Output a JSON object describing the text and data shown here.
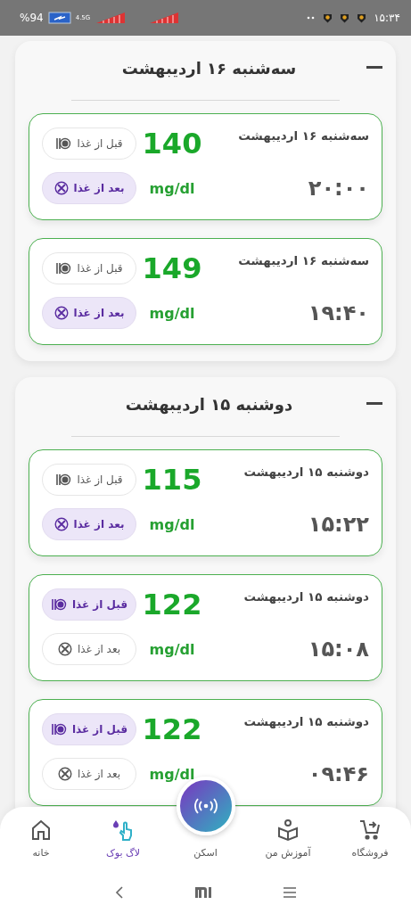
{
  "status_bar": {
    "time": "۱۵:۳۴",
    "battery": "%94",
    "network": "4.5G"
  },
  "days": [
    {
      "title": "سه‌شنبه ۱۶ اردیبهشت",
      "expanded": true,
      "entries": [
        {
          "date": "سه‌شنبه ۱۶ اردیبهشت",
          "value": "140",
          "unit": "mg/dl",
          "time": "۲۰:۰۰",
          "tags": [
            {
              "kind": "before",
              "label": "قبل از غذا",
              "selected": false
            },
            {
              "kind": "after",
              "label": "بعد از غذا",
              "selected": true
            }
          ]
        },
        {
          "date": "سه‌شنبه ۱۶ اردیبهشت",
          "value": "149",
          "unit": "mg/dl",
          "time": "۱۹:۴۰",
          "tags": [
            {
              "kind": "before",
              "label": "قبل از غذا",
              "selected": false
            },
            {
              "kind": "after",
              "label": "بعد از غذا",
              "selected": true
            }
          ]
        }
      ]
    },
    {
      "title": "دوشنبه ۱۵ اردیبهشت",
      "expanded": true,
      "entries": [
        {
          "date": "دوشنبه ۱۵ اردیبهشت",
          "value": "115",
          "unit": "mg/dl",
          "time": "۱۵:۲۲",
          "tags": [
            {
              "kind": "before",
              "label": "قبل از غذا",
              "selected": false
            },
            {
              "kind": "after",
              "label": "بعد از غذا",
              "selected": true
            }
          ]
        },
        {
          "date": "دوشنبه ۱۵ اردیبهشت",
          "value": "122",
          "unit": "mg/dl",
          "time": "۱۵:۰۸",
          "tags": [
            {
              "kind": "before",
              "label": "قبل از غذا",
              "selected": true
            },
            {
              "kind": "after",
              "label": "بعد از غذا",
              "selected": false
            }
          ]
        },
        {
          "date": "دوشنبه ۱۵ اردیبهشت",
          "value": "122",
          "unit": "mg/dl",
          "time": "۰۹:۴۶",
          "tags": [
            {
              "kind": "before",
              "label": "قبل از غذا",
              "selected": true
            },
            {
              "kind": "after",
              "label": "بعد از غذا",
              "selected": false
            }
          ]
        }
      ]
    }
  ],
  "nav": [
    {
      "kind": "shop",
      "label": "فروشگاه",
      "selected": false
    },
    {
      "kind": "learn",
      "label": "آموزش من",
      "selected": false
    },
    {
      "kind": "scan",
      "label": "اسکن",
      "selected": false
    },
    {
      "kind": "logbook",
      "label": "لاگ بوک",
      "selected": true
    },
    {
      "kind": "home",
      "label": "خانه",
      "selected": false
    }
  ]
}
